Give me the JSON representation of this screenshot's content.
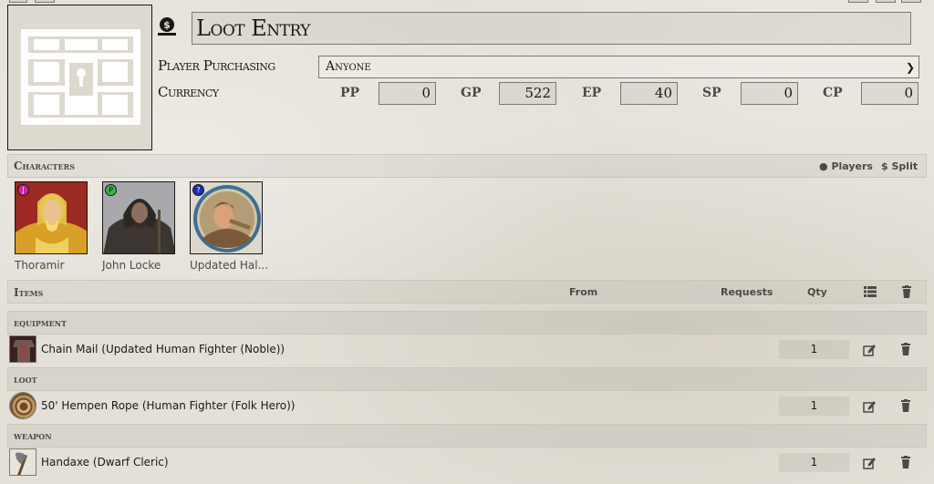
{
  "window": {
    "title": "Loot Entry"
  },
  "form": {
    "player_label": "Player Purchasing",
    "player_value": "Anyone",
    "currency_label": "Currency",
    "currency": [
      {
        "code": "PP",
        "value": "0"
      },
      {
        "code": "GP",
        "value": "522"
      },
      {
        "code": "EP",
        "value": "40"
      },
      {
        "code": "SP",
        "value": "0"
      },
      {
        "code": "CP",
        "value": "0"
      }
    ]
  },
  "characters": {
    "title": "Characters",
    "players_label": "Players",
    "split_label": "Split",
    "list": [
      {
        "name": "Thoramir",
        "owner": "J",
        "owner_color": "#c5289a"
      },
      {
        "name": "John Locke",
        "owner": "P",
        "owner_color": "#2fb84a"
      },
      {
        "name": "Updated Hal...",
        "owner": "?",
        "owner_color": "#1d2bb8"
      }
    ]
  },
  "items": {
    "title": "Items",
    "col_from": "From",
    "col_requests": "Requests",
    "col_qty": "Qty",
    "groups": [
      {
        "name": "equipment",
        "item": "Chain Mail (Updated Human Fighter (Noble))",
        "qty": "1",
        "icon": "chain-mail-icon"
      },
      {
        "name": "loot",
        "item": "50' Hempen Rope (Human Fighter (Folk Hero))",
        "qty": "1",
        "icon": "rope-icon"
      },
      {
        "name": "weapon",
        "item": "Handaxe (Dwarf Cleric)",
        "qty": "1",
        "icon": "handaxe-icon"
      }
    ]
  },
  "colors": {
    "background": "#e4e0d7",
    "text": "#191813",
    "muted": "#4b4a44",
    "border": "#7a7971"
  }
}
